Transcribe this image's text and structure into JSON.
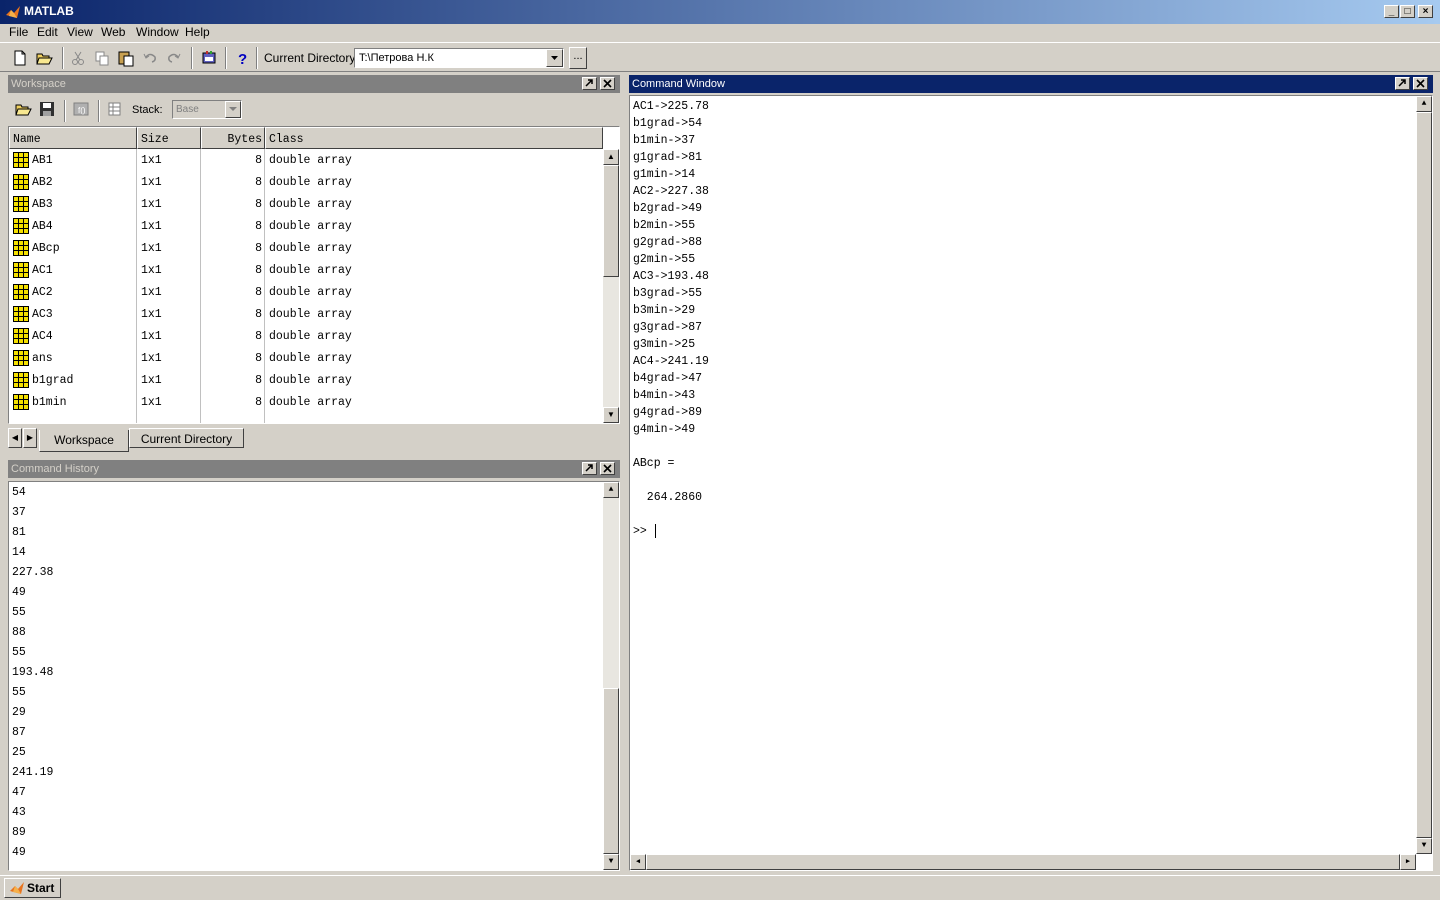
{
  "window": {
    "title": "MATLAB"
  },
  "menu": [
    "File",
    "Edit",
    "View",
    "Web",
    "Window",
    "Help"
  ],
  "toolbar": {
    "current_directory_label": "Current Directory:",
    "current_directory_value": "T:\\Петрова Н.К",
    "browse_label": "..."
  },
  "workspace": {
    "title": "Workspace",
    "stack_label": "Stack:",
    "stack_value": "Base",
    "columns": [
      "Name",
      "Size",
      "Bytes",
      "Class"
    ],
    "rows": [
      {
        "name": "AB1",
        "size": "1x1",
        "bytes": "8",
        "class": "double array"
      },
      {
        "name": "AB2",
        "size": "1x1",
        "bytes": "8",
        "class": "double array"
      },
      {
        "name": "AB3",
        "size": "1x1",
        "bytes": "8",
        "class": "double array"
      },
      {
        "name": "AB4",
        "size": "1x1",
        "bytes": "8",
        "class": "double array"
      },
      {
        "name": "ABcp",
        "size": "1x1",
        "bytes": "8",
        "class": "double array"
      },
      {
        "name": "AC1",
        "size": "1x1",
        "bytes": "8",
        "class": "double array"
      },
      {
        "name": "AC2",
        "size": "1x1",
        "bytes": "8",
        "class": "double array"
      },
      {
        "name": "AC3",
        "size": "1x1",
        "bytes": "8",
        "class": "double array"
      },
      {
        "name": "AC4",
        "size": "1x1",
        "bytes": "8",
        "class": "double array"
      },
      {
        "name": "ans",
        "size": "1x1",
        "bytes": "8",
        "class": "double array"
      },
      {
        "name": "b1grad",
        "size": "1x1",
        "bytes": "8",
        "class": "double array"
      },
      {
        "name": "b1min",
        "size": "1x1",
        "bytes": "8",
        "class": "double array"
      }
    ],
    "tabs": [
      "Workspace",
      "Current Directory"
    ]
  },
  "history": {
    "title": "Command History",
    "lines": [
      "54",
      "37",
      "81",
      "14",
      "227.38",
      "49",
      "55",
      "88",
      "55",
      "193.48",
      "55",
      "29",
      "87",
      "25",
      "241.19",
      "47",
      "43",
      "89",
      "49"
    ]
  },
  "command_window": {
    "title": "Command Window",
    "lines": [
      "AC1->225.78",
      "b1grad->54",
      "b1min->37",
      "g1grad->81",
      "g1min->14",
      "AC2->227.38",
      "b2grad->49",
      "b2min->55",
      "g2grad->88",
      "g2min->55",
      "AC3->193.48",
      "b3grad->55",
      "b3min->29",
      "g3grad->87",
      "g3min->25",
      "AC4->241.19",
      "b4grad->47",
      "b4min->43",
      "g4grad->89",
      "g4min->49",
      "",
      "ABcp =",
      "",
      "  264.2860",
      "",
      ">> "
    ]
  },
  "taskbar": {
    "start_label": "Start"
  },
  "icons": [
    "matlab-logo-icon",
    "new-file-icon",
    "open-folder-icon",
    "cut-icon",
    "copy-icon",
    "paste-icon",
    "undo-icon",
    "redo-icon",
    "simulink-icon",
    "help-icon",
    "save-icon",
    "import-data-icon",
    "array-icon",
    "undock-icon",
    "close-icon"
  ]
}
